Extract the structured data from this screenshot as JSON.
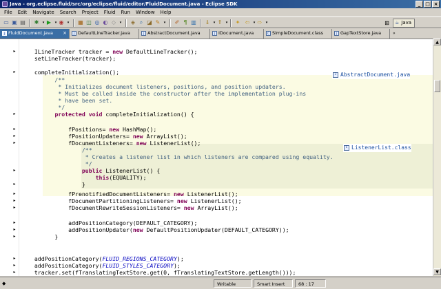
{
  "window": {
    "title": "Java - org.eclipse.fluid/src/org/eclipse/fluid/editor/FluidDocument.java - Eclipse SDK"
  },
  "menu": [
    "File",
    "Edit",
    "Navigate",
    "Search",
    "Project",
    "Fluid",
    "Run",
    "Window",
    "Help"
  ],
  "perspective": {
    "label": "Java"
  },
  "tabs": [
    {
      "label": "FluidDocument.java",
      "active": true
    },
    {
      "label": "DefaultLineTracker.java",
      "active": false
    },
    {
      "label": "AbstractDocument.java",
      "active": false
    },
    {
      "label": "IDocument.java",
      "active": false
    },
    {
      "label": "SimpleDocument.class",
      "active": false
    },
    {
      "label": "GapTextStore.java",
      "active": false
    }
  ],
  "code": [
    {
      "text": "  ILineTracker tracker = new DefaultLineTracker();",
      "kind": "code"
    },
    {
      "text": "  setLineTracker(tracker);",
      "kind": "code"
    },
    {
      "text": "",
      "kind": "code"
    },
    {
      "text": "  completeInitialization();",
      "kind": "code"
    },
    {
      "text": "        /**",
      "kind": "cmt"
    },
    {
      "text": "         * Initializes document listeners, positions, and position updaters.",
      "kind": "cmt"
    },
    {
      "text": "         * Must be called inside the constructor after the implementation plug-ins",
      "kind": "cmt"
    },
    {
      "text": "         * have been set.",
      "kind": "cmt"
    },
    {
      "text": "         */",
      "kind": "cmt"
    },
    {
      "text": "        protected void completeInitialization() {",
      "kind": "code"
    },
    {
      "text": "",
      "kind": "code"
    },
    {
      "text": "            fPositions= new HashMap();",
      "kind": "code"
    },
    {
      "text": "            fPositionUpdaters= new ArrayList();",
      "kind": "code"
    },
    {
      "text": "            fDocumentListeners= new ListenerList();",
      "kind": "code"
    },
    {
      "text": "                /**",
      "kind": "cmt"
    },
    {
      "text": "                 * Creates a listener list in which listeners are compared using equality.",
      "kind": "cmt"
    },
    {
      "text": "                 */",
      "kind": "cmt"
    },
    {
      "text": "                public ListenerList() {",
      "kind": "code"
    },
    {
      "text": "                    this(EQUALITY);",
      "kind": "code"
    },
    {
      "text": "                }",
      "kind": "code"
    },
    {
      "text": "            fPrenotifiedDocumentListeners= new ListenerList();",
      "kind": "code"
    },
    {
      "text": "            fDocumentPartitioningListeners= new ListenerList();",
      "kind": "code"
    },
    {
      "text": "            fDocumentRewriteSessionListeners= new ArrayList();",
      "kind": "code"
    },
    {
      "text": "",
      "kind": "code"
    },
    {
      "text": "            addPositionCategory(DEFAULT_CATEGORY);",
      "kind": "code"
    },
    {
      "text": "            addPositionUpdater(new DefaultPositionUpdater(DEFAULT_CATEGORY));",
      "kind": "code"
    },
    {
      "text": "        }",
      "kind": "code"
    },
    {
      "text": "",
      "kind": "code"
    },
    {
      "text": "",
      "kind": "code"
    },
    {
      "text": "  addPositionCategory(FLUID_REGIONS_CATEGORY);",
      "kind": "code"
    },
    {
      "text": "  addPositionCategory(FLUID_STYLES_CATEGORY);",
      "kind": "code"
    },
    {
      "text": "  tracker.set(fTranslatingTextStore.get(0, fTranslatingTextStore.getLength()));",
      "kind": "code"
    }
  ],
  "callouts": [
    {
      "label": "AbstractDocument.java"
    },
    {
      "label": "ListenerList.class"
    }
  ],
  "status": {
    "writable": "Writable",
    "insert_mode": "Smart Insert",
    "position": "68 : 17"
  }
}
